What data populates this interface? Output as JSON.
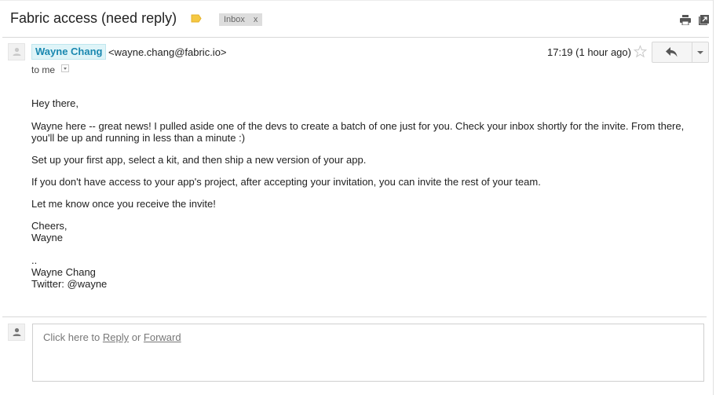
{
  "thread": {
    "subject": "Fabric access (need reply)",
    "label_tag_color": "#f5c842",
    "label_chip": {
      "text": "Inbox",
      "remove": "x"
    }
  },
  "toolbar": {
    "print_icon": "print-icon",
    "popout_icon": "new-window-icon"
  },
  "message": {
    "sender_name": "Wayne Chang",
    "sender_email": "<wayne.chang@fabric.io>",
    "recipient": "to me",
    "timestamp": "17:19 (1 hour ago)",
    "starred": false,
    "body": {
      "greeting": "Hey there,",
      "p1": "Wayne here -- great news! I pulled aside one of the devs to create a batch of one just for you. Check your inbox shortly for the invite. From there, you'll be up and running in less than a minute :)",
      "p2": "Set up your first app, select a kit, and then ship a new version of your app.",
      "p3": "If you don't have access to your app's project, after accepting your invitation, you can invite the rest of your team.",
      "p4": "Let me know once you receive the invite!",
      "closing_1": "Cheers,",
      "closing_2": "Wayne",
      "sig_sep": "..",
      "sig_name": "Wayne Chang",
      "sig_twitter": "Twitter: @wayne"
    }
  },
  "reply_box": {
    "prefix": "Click here to ",
    "reply_link": "Reply",
    "middle": " or ",
    "forward_link": "Forward"
  }
}
